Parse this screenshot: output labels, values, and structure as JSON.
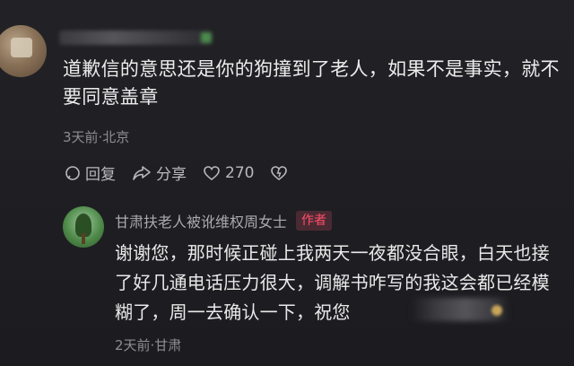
{
  "comment": {
    "text": "道歉信的意思还是你的狗撞到了老人，如果不是事实，就不要同意盖章",
    "meta": "3天前·北京",
    "actions": {
      "reply_label": "回复",
      "share_label": "分享",
      "like_count": "270"
    }
  },
  "reply": {
    "username": "甘肃扶老人被讹维权周女士",
    "author_badge": "作者",
    "text": "谢谢您，那时候正碰上我两天一夜都没合眼，白天也接了好几通电话压力很大，调解书咋写的我这会都已经模糊了，周一去确认一下，祝您",
    "meta": "2天前·甘肃"
  },
  "colors": {
    "background": "#1f1f23",
    "author_badge": "#ff4f6a",
    "meta_text": "#8d8d92"
  },
  "icons": [
    "comment-icon",
    "share-icon",
    "heart-icon",
    "dislike-heart-icon"
  ]
}
